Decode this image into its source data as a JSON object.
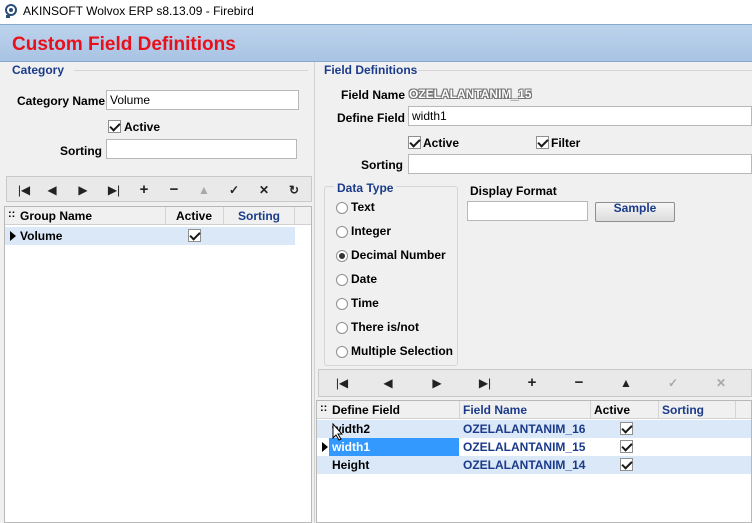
{
  "window": {
    "title": "AKINSOFT Wolvox ERP s8.13.09 - Firebird"
  },
  "header": {
    "title": "Custom Field Definitions"
  },
  "category": {
    "group_title": "Category",
    "name_label": "Category Name",
    "name_value": "Volume",
    "active_label": "Active",
    "active_checked": true,
    "sorting_label": "Sorting",
    "sorting_value": "",
    "grid": {
      "headers": [
        "Group Name",
        "Active",
        "Sorting"
      ],
      "rows": [
        {
          "group_name": "Volume",
          "active": true,
          "sorting": ""
        }
      ]
    }
  },
  "field_defs": {
    "group_title": "Field Definitions",
    "field_name_label": "Field Name",
    "field_name_value": "OZELALANTANIM_15",
    "define_field_label": "Define Field",
    "define_field_value": "width1",
    "active_label": "Active",
    "filter_label": "Filter",
    "sorting_label": "Sorting",
    "sorting_value": "",
    "data_type": {
      "title": "Data Type",
      "options": [
        "Text",
        "Integer",
        "Decimal Number",
        "Date",
        "Time",
        "There is/not",
        "Multiple Selection"
      ],
      "selected": "Decimal Number"
    },
    "display_format_label": "Display Format",
    "display_format_value": "",
    "sample_button": "Sample",
    "grid": {
      "headers": [
        "Define Field",
        "Field Name",
        "Active",
        "Sorting"
      ],
      "rows": [
        {
          "define_field": "width2",
          "field_name": "OZELALANTANIM_16",
          "active": true,
          "sorting": ""
        },
        {
          "define_field": "width1",
          "field_name": "OZELALANTANIM_15",
          "active": true,
          "sorting": ""
        },
        {
          "define_field": "Height",
          "field_name": "OZELALANTANIM_14",
          "active": true,
          "sorting": ""
        }
      ]
    }
  },
  "nav_icons": [
    "first-icon",
    "prior-icon",
    "next-icon",
    "last-icon",
    "insert-icon",
    "delete-icon",
    "edit-icon",
    "post-icon",
    "cancel-icon",
    "refresh-icon"
  ]
}
